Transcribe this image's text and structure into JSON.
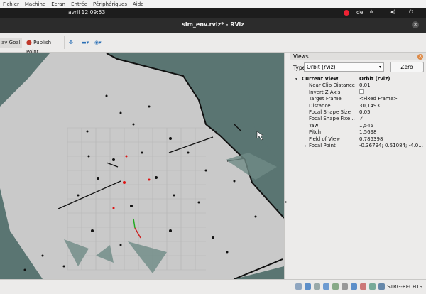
{
  "host_menu": [
    "Fichier",
    "Machine",
    "Écran",
    "Entrée",
    "Périphériques",
    "Aide"
  ],
  "panel": {
    "clock": "avril 12  09:53",
    "language": "de",
    "tray_icons": [
      "network-icon",
      "volume-icon",
      "power-icon"
    ]
  },
  "window": {
    "title": "sim_env.rviz* - RViz"
  },
  "toolbar": {
    "nav_goal_label": "av Goal",
    "publish_point_label": "Publish Point"
  },
  "views_panel": {
    "title": "Views",
    "type_label": "Type:",
    "type_value": "Orbit (rviz)",
    "zero_label": "Zero",
    "header": {
      "key": "Current View",
      "value": "Orbit (rviz)"
    },
    "properties": [
      {
        "key": "Near Clip Distance",
        "value": "0,01"
      },
      {
        "key": "Invert Z Axis",
        "value": ""
      },
      {
        "key": "Target Frame",
        "value": "<Fixed Frame>"
      },
      {
        "key": "Distance",
        "value": "30,1493"
      },
      {
        "key": "Focal Shape Size",
        "value": "0,05"
      },
      {
        "key": "Focal Shape Fixe...",
        "value": "✓"
      },
      {
        "key": "Yaw",
        "value": "1,545"
      },
      {
        "key": "Pitch",
        "value": "1,5698"
      },
      {
        "key": "Field of View",
        "value": "0,785398"
      },
      {
        "key": "Focal Point",
        "value": "-0.36794; 0.51084; -4.0..."
      }
    ]
  },
  "statusbar": {
    "keyboard_hint": "STRG-RECHTS"
  },
  "colors": {
    "map_background": "#5a7572",
    "map_free": "#c8c8c8",
    "panel": "#ecebea"
  }
}
